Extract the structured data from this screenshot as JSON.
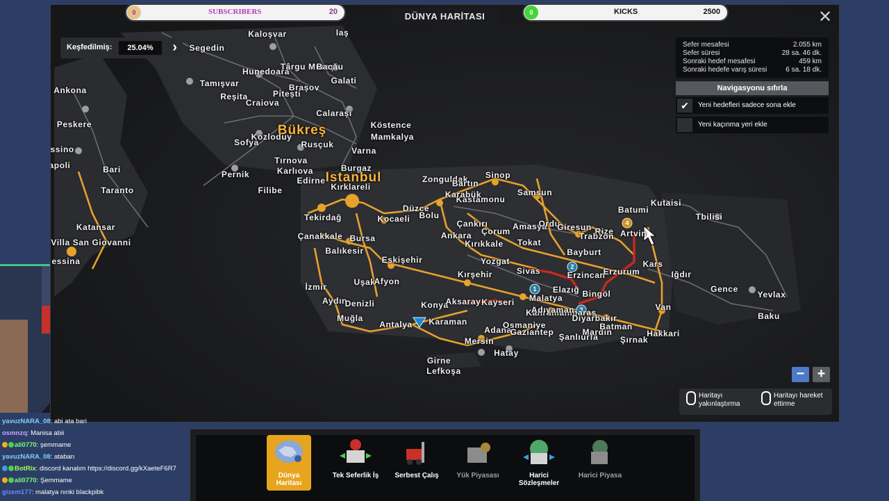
{
  "window": {
    "title": "DÜNYA HARİTASI",
    "close": "✕"
  },
  "counters": {
    "subscribers": {
      "count": "0",
      "label": "SUBSCRIBERS",
      "goal": "20"
    },
    "kicks": {
      "count": "0",
      "label": "KICKS",
      "goal": "2500"
    }
  },
  "explored": {
    "label": "Keşfedilmiş:",
    "value": "25.04%"
  },
  "info": [
    {
      "label": "Sefer mesafesi",
      "value": "2.055 km"
    },
    {
      "label": "Sefer süresi",
      "value": "28 sa. 46 dk."
    },
    {
      "label": "Sonraki hedef mesafesi",
      "value": "459 km"
    },
    {
      "label": "Sonraki hedefe varış süresi",
      "value": "6 sa. 18 dk."
    }
  ],
  "nav": {
    "reset": "Navigasyonu sıfırla",
    "option1": "Yeni hedefleri sadece sona ekle",
    "option1_checked": true,
    "option2": "Yeni kaçınma yeri ekle",
    "option2_checked": false
  },
  "zoom": {
    "minus": "−",
    "plus": "+"
  },
  "hints": {
    "zoom": "Haritayı yakınlaştırma",
    "move": "Haritayı hareket ettirme"
  },
  "bottom_menu": [
    {
      "label": "Dünya Haritası",
      "active": true
    },
    {
      "label": "Tek Seferlik İş",
      "active": false
    },
    {
      "label": "Serbest Çalış",
      "active": false
    },
    {
      "label": "Yük Piyasası",
      "active": false,
      "dim": true
    },
    {
      "label": "Harici Sözleşmeler",
      "active": false
    },
    {
      "label": "Harici Piyasa",
      "active": false,
      "dim": true
    }
  ],
  "map_labels": [
    {
      "t": "Kaloşvar"
    },
    {
      "t": "Iaş"
    },
    {
      "t": "Segedin"
    },
    {
      "t": "Hunedoara"
    },
    {
      "t": "Târgu Mureş"
    },
    {
      "t": "Bacău"
    },
    {
      "t": "Brașov"
    },
    {
      "t": "Galati"
    },
    {
      "t": "Tamışvar"
    },
    {
      "t": "Pitești"
    },
    {
      "t": "Reşita"
    },
    {
      "t": "Craiova"
    },
    {
      "t": "Ankona"
    },
    {
      "t": "Calarași"
    },
    {
      "t": "Köstence"
    },
    {
      "t": "Peskere"
    },
    {
      "t": "Bükreş",
      "big": true
    },
    {
      "t": "Mamkalya"
    },
    {
      "t": "Sofya"
    },
    {
      "t": "Rusçuk"
    },
    {
      "t": "Kozloduy"
    },
    {
      "t": "Varna"
    },
    {
      "t": "assino"
    },
    {
      "t": "apoli"
    },
    {
      "t": "Bari"
    },
    {
      "t": "Tırnova"
    },
    {
      "t": "Pernik"
    },
    {
      "t": "Karlıova"
    },
    {
      "t": "Burgaz"
    },
    {
      "t": "Taranto"
    },
    {
      "t": "Edirne"
    },
    {
      "t": "Kırklareli"
    },
    {
      "t": "Istanbul",
      "big": true
    },
    {
      "t": "Zonguldak"
    },
    {
      "t": "Bartın"
    },
    {
      "t": "Sinop"
    },
    {
      "t": "Samsun"
    },
    {
      "t": "Filibe"
    },
    {
      "t": "Tekirdağ"
    },
    {
      "t": "Düzce"
    },
    {
      "t": "Kastamonu"
    },
    {
      "t": "Karabük"
    },
    {
      "t": "Katansar"
    },
    {
      "t": "Villa San Giovanni"
    },
    {
      "t": "essina"
    },
    {
      "t": "Kocaeli"
    },
    {
      "t": "Bolu"
    },
    {
      "t": "Çorum"
    },
    {
      "t": "Amasya"
    },
    {
      "t": "Ordu"
    },
    {
      "t": "Giresun"
    },
    {
      "t": "Rize"
    },
    {
      "t": "Batumi"
    },
    {
      "t": "Kutaisi"
    },
    {
      "t": "Tbilisi"
    },
    {
      "t": "Artvin"
    },
    {
      "t": "Trabzon"
    },
    {
      "t": "Çanakkale"
    },
    {
      "t": "Bursa"
    },
    {
      "t": "Ankara"
    },
    {
      "t": "Çankırı"
    },
    {
      "t": "Kırıkkale"
    },
    {
      "t": "Tokat"
    },
    {
      "t": "Balıkesir"
    },
    {
      "t": "Eskişehir"
    },
    {
      "t": "Yozgat"
    },
    {
      "t": "Bayburt"
    },
    {
      "t": "Kars"
    },
    {
      "t": "Sivas"
    },
    {
      "t": "Erzincan"
    },
    {
      "t": "Erzurum"
    },
    {
      "t": "Iğdır"
    },
    {
      "t": "Kırşehir"
    },
    {
      "t": "Uşak"
    },
    {
      "t": "Afyon"
    },
    {
      "t": "İzmir"
    },
    {
      "t": "Elazığ"
    },
    {
      "t": "Bingöl"
    },
    {
      "t": "Gence"
    },
    {
      "t": "Yevlax"
    },
    {
      "t": "Aydın"
    },
    {
      "t": "Denizli"
    },
    {
      "t": "Konya"
    },
    {
      "t": "Aksaray"
    },
    {
      "t": "Kayseri"
    },
    {
      "t": "Malatya"
    },
    {
      "t": "Van"
    },
    {
      "t": "Kahramanmaraş"
    },
    {
      "t": "Adıyaman"
    },
    {
      "t": "Diyarbakır"
    },
    {
      "t": "Baku"
    },
    {
      "t": "Muğla"
    },
    {
      "t": "Antalya"
    },
    {
      "t": "Karaman"
    },
    {
      "t": "Adana"
    },
    {
      "t": "Osmaniye"
    },
    {
      "t": "Gaziantep"
    },
    {
      "t": "Şanlıurfa"
    },
    {
      "t": "Mardin"
    },
    {
      "t": "Batman"
    },
    {
      "t": "Hakkari"
    },
    {
      "t": "Şırnak"
    },
    {
      "t": "Mersin"
    },
    {
      "t": "Hatay"
    },
    {
      "t": "Girne"
    },
    {
      "t": "Lefkoşa"
    }
  ],
  "chat": [
    {
      "user": "yavuzNARA_08",
      "msg": ": abi ata bari",
      "color": "#7fd0ff",
      "badge": ""
    },
    {
      "user": "osmnzq",
      "msg": ": Manisa abii",
      "color": "#c8a2ff",
      "badge": ""
    },
    {
      "user": "ali0770",
      "msg": ": şemmame",
      "color": "#7aff7a",
      "badge": "g"
    },
    {
      "user": "yavuzNARA_08",
      "msg": ": atabarı",
      "color": "#7fd0ff",
      "badge": ""
    },
    {
      "user": "BotRix",
      "msg": ": discord kanalım https://discord.gg/kXaeteF6R7",
      "color": "#a4ff5c",
      "badge": "b"
    },
    {
      "user": "ali0770",
      "msg": ": Şemmame",
      "color": "#7aff7a",
      "badge": "g"
    },
    {
      "user": "gizem177",
      "msg": ": malatya nınki blackpibk",
      "color": "#6a8cff",
      "badge": ""
    }
  ]
}
